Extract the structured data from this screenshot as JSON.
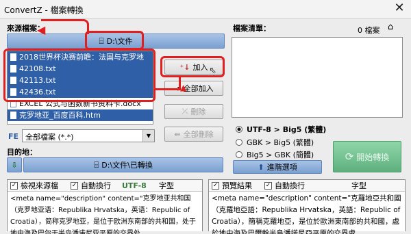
{
  "window": {
    "title": "ConvertZ - 檔案轉換",
    "close_glyph": "✕"
  },
  "source": {
    "label": "來源檔案：",
    "folder": "D:\\文件",
    "files": [
      {
        "name": "2018世界杯決赛前瞻：法国与克罗地",
        "selected": true
      },
      {
        "name": "42108.txt",
        "selected": true
      },
      {
        "name": "42113.txt",
        "selected": true
      },
      {
        "name": "42436.txt",
        "selected": true
      },
      {
        "name": "EXCEL 公式与函数新书资料卡.docx",
        "selected": false
      },
      {
        "name": "克罗地亚_百度百科.htm",
        "selected": true
      }
    ]
  },
  "buttons": {
    "add": "加入",
    "add_all": "全部加入",
    "remove": "刪除",
    "remove_all": "全部刪除",
    "advanced": "進階選項",
    "start": "開始轉換"
  },
  "filter": {
    "fe": "FE",
    "value": "全部檔案 (*.*)"
  },
  "destination": {
    "label": "目的地：",
    "folder": "D:\\文件\\已轉換"
  },
  "filelist": {
    "label": "檔案清單：",
    "count": "0 檔案"
  },
  "modes": [
    {
      "label": "UTF-8 > Big5 (繁體)",
      "selected": true
    },
    {
      "label": "GBK > Big5 (繁體)",
      "selected": false
    },
    {
      "label": "Big5 > GBK (簡體)",
      "selected": false
    }
  ],
  "left_panel": {
    "check1": "檢視來源檔",
    "check2": "自動換行",
    "encoding": "UTF-8",
    "font_label": "字型",
    "content": "<meta name=\"description\" content=\"克罗地亚共和国（克罗地亚语：Republika Hrvatska，英语：Republic of Croatia），简称克罗地亚，是位于欧洲东南部的共和国，处于地中海及巴尔干半岛潘诺尼亚平原的交界处"
  },
  "right_panel": {
    "check1": "預覽結果",
    "check2": "自動換行",
    "font_label": "字型",
    "content": "<meta name=\"description\" content=\"克羅地亞共和國（克羅地亞語：Republika Hrvatska，英語：Republic of Croatia），簡稱克羅地亞，是位於歐洲東南部的共和國，處於地中海及巴爾幹半島潘諾尼亞平原的交界處"
  },
  "colors": {
    "accent": "#2f5fa6",
    "highlight": "#e02020",
    "start_button": "#6fbf8f"
  }
}
